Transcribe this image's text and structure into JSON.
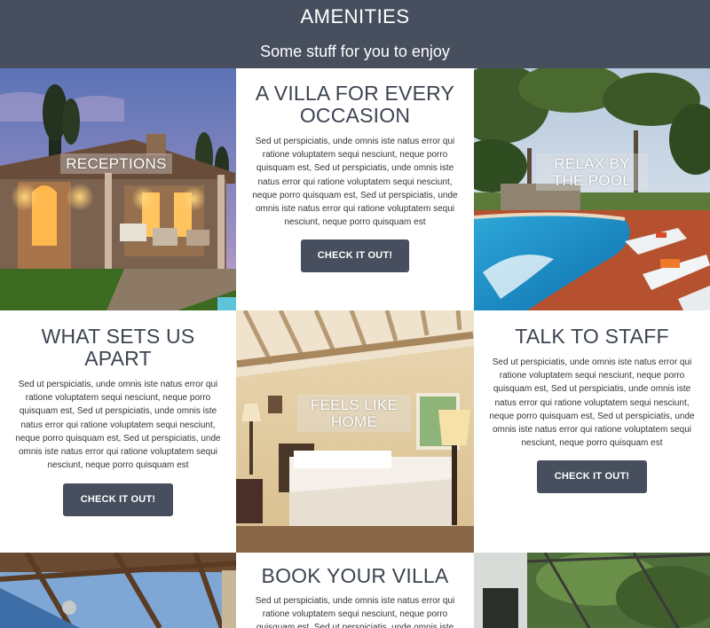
{
  "header": {
    "title": "AMENITIES",
    "subtitle": "Some stuff for you to enjoy"
  },
  "tiles": {
    "receptions": {
      "label": "RECEPTIONS"
    },
    "villa": {
      "title": "A VILLA FOR EVERY OCCASION",
      "body": "Sed ut perspiciatis, unde omnis iste natus error qui ratione voluptatem sequi nesciunt, neque porro quisquam est, Sed ut perspiciatis, unde omnis iste natus error qui ratione voluptatem sequi nesciunt, neque porro quisquam est, Sed ut perspiciatis, unde omnis iste natus error qui ratione voluptatem sequi nesciunt, neque porro quisquam est",
      "button": "CHECK IT OUT!"
    },
    "pool": {
      "label_line1": "RELAX BY",
      "label_line2": "THE POOL"
    },
    "apart": {
      "title": "WHAT SETS US APART",
      "body": "Sed ut perspiciatis, unde omnis iste natus error qui ratione voluptatem sequi nesciunt, neque porro quisquam est, Sed ut perspiciatis, unde omnis iste natus error qui ratione voluptatem sequi nesciunt, neque porro quisquam est, Sed ut perspiciatis, unde omnis iste natus error qui ratione voluptatem sequi nesciunt, neque porro quisquam est",
      "button": "CHECK IT OUT!"
    },
    "home": {
      "label_line1": "FEELS LIKE",
      "label_line2": "HOME"
    },
    "staff": {
      "title": "TALK TO STAFF",
      "body": "Sed ut perspiciatis, unde omnis iste natus error qui ratione voluptatem sequi nesciunt, neque porro quisquam est, Sed ut perspiciatis, unde omnis iste natus error qui ratione voluptatem sequi nesciunt, neque porro quisquam est, Sed ut perspiciatis, unde omnis iste natus error qui ratione voluptatem sequi nesciunt, neque porro quisquam est",
      "button": "CHECK IT OUT!"
    },
    "book": {
      "title": "BOOK YOUR VILLA",
      "body": "Sed ut perspiciatis, unde omnis iste natus error qui ratione voluptatem sequi nesciunt, neque porro quisquam est, Sed ut perspiciatis, unde omnis iste natus error qui"
    }
  },
  "colors": {
    "header_bg": "#474f5e",
    "button_bg": "#474f5e",
    "heading": "#3d4450"
  }
}
